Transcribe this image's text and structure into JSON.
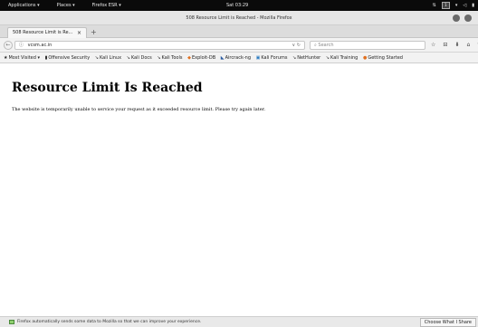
{
  "topbar": {
    "applications": "Applications ▾",
    "places": "Places ▾",
    "app": "Firefox ESR ▾",
    "clock": "Sat 03:29"
  },
  "window": {
    "title": "508 Resource Limit is Reached - Mozilla Firefox"
  },
  "tabs": [
    {
      "label": "508 Resource Limit is Re...",
      "close": "×"
    }
  ],
  "new_tab": "+",
  "navbar": {
    "back": "←",
    "url": "vcsm.ac.in",
    "info": "ⓘ",
    "url_tools": "∨  ↻",
    "search_placeholder": "Search",
    "icons": [
      "☆",
      "⊟",
      "⬇",
      "⌂",
      "♥"
    ]
  },
  "bookmarks": [
    {
      "icon": "★",
      "label": "Most Visited ▾"
    },
    {
      "icon": "▮",
      "label": "Offensive Security"
    },
    {
      "icon": "↘",
      "label": "Kali Linux"
    },
    {
      "icon": "↘",
      "label": "Kali Docs"
    },
    {
      "icon": "↘",
      "label": "Kali Tools"
    },
    {
      "icon": "◆",
      "label": "Exploit-DB"
    },
    {
      "icon": "◣",
      "label": "Aircrack-ng"
    },
    {
      "icon": "▣",
      "label": "Kali Forums"
    },
    {
      "icon": "↘",
      "label": "NetHunter"
    },
    {
      "icon": "↘",
      "label": "Kali Training"
    },
    {
      "icon": "●",
      "label": "Getting Started"
    }
  ],
  "page": {
    "heading": "Resource Limit Is Reached",
    "body": "The website is temporarily unable to service your request as it exceeded resource limit. Please try again later."
  },
  "notification": {
    "text": "Firefox automatically sends some data to Mozilla so that we can improve your experience.",
    "button": "Choose What I Share"
  }
}
